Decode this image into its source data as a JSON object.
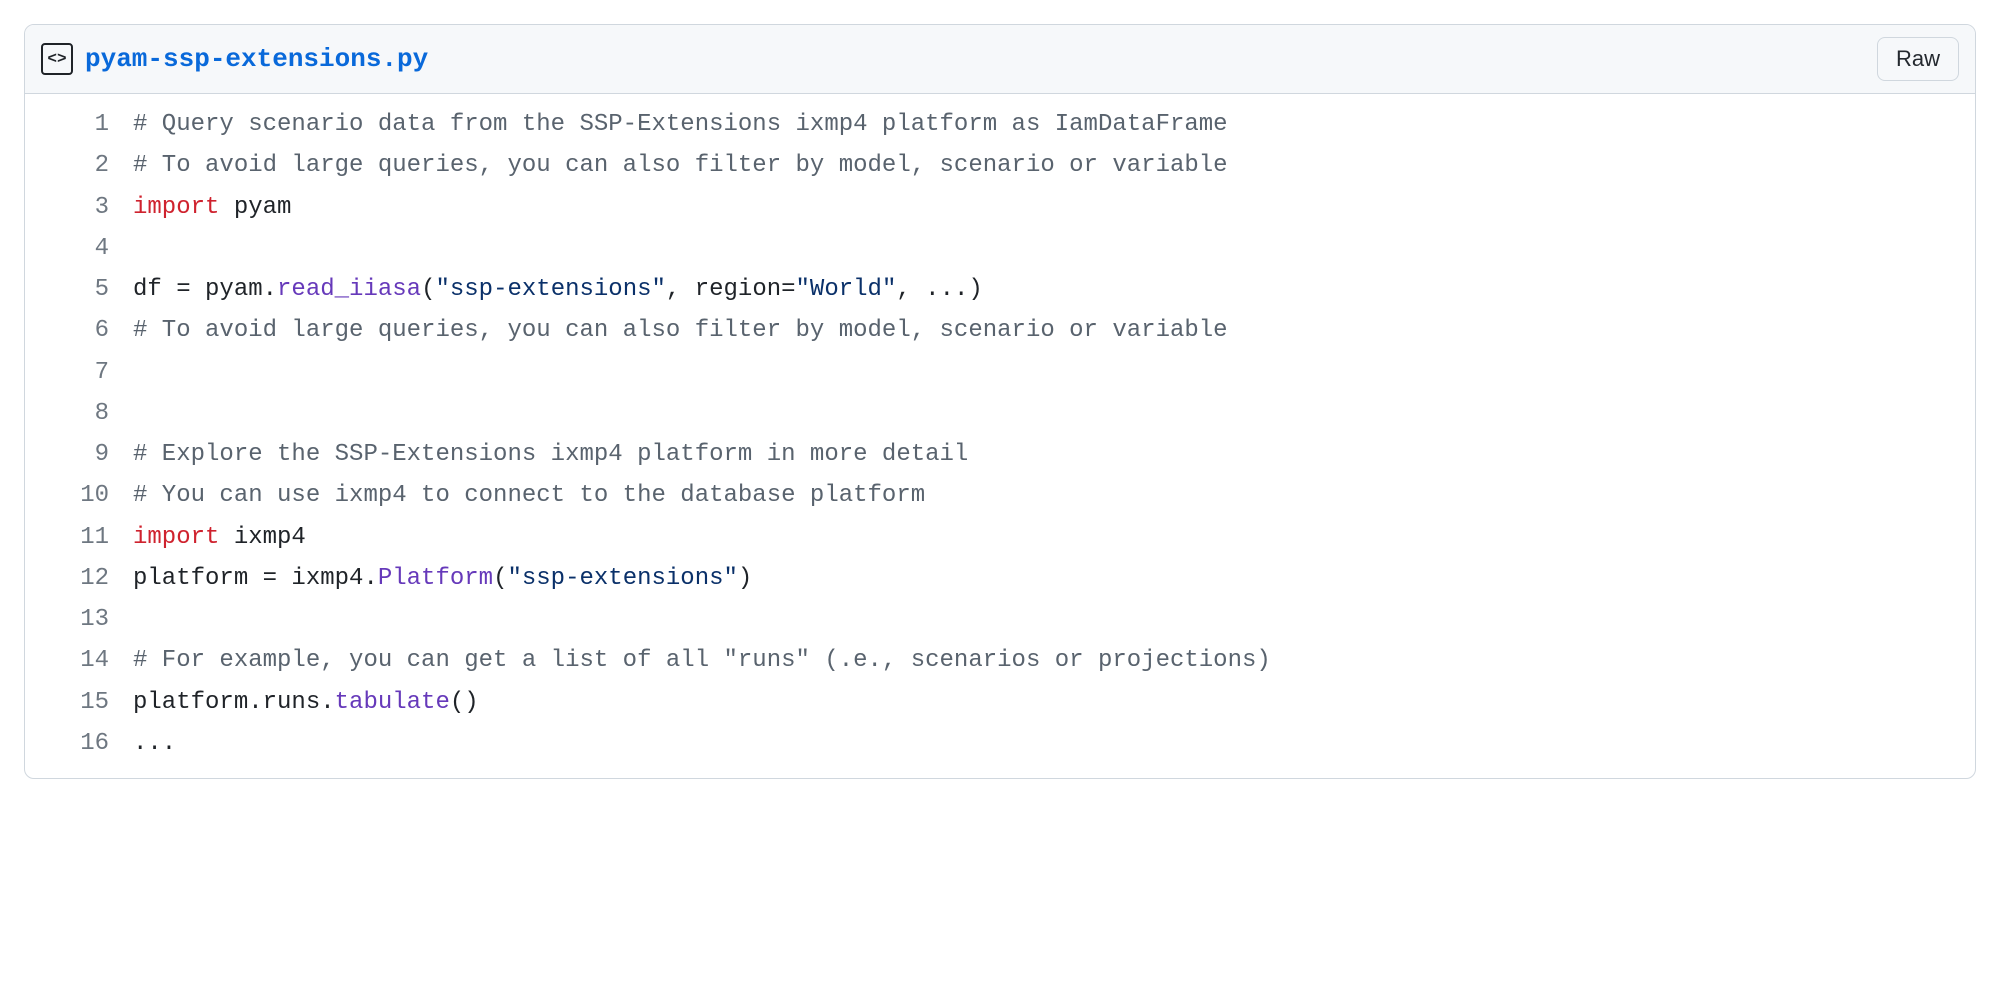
{
  "header": {
    "icon_glyph": "<>",
    "filename": "pyam-ssp-extensions.py",
    "raw_label": "Raw"
  },
  "code": {
    "lines": [
      {
        "n": "1",
        "tokens": [
          {
            "cls": "tok-comment",
            "t": "# Query scenario data from the SSP-Extensions ixmp4 platform as IamDataFrame"
          }
        ]
      },
      {
        "n": "2",
        "tokens": [
          {
            "cls": "tok-comment",
            "t": "# To avoid large queries, you can also filter by model, scenario or variable"
          }
        ]
      },
      {
        "n": "3",
        "tokens": [
          {
            "cls": "tok-keyword",
            "t": "import"
          },
          {
            "cls": "tok-default",
            "t": " pyam"
          }
        ]
      },
      {
        "n": "4",
        "tokens": [
          {
            "cls": "tok-default",
            "t": ""
          }
        ]
      },
      {
        "n": "5",
        "tokens": [
          {
            "cls": "tok-default",
            "t": "df = pyam."
          },
          {
            "cls": "tok-func",
            "t": "read_iiasa"
          },
          {
            "cls": "tok-default",
            "t": "("
          },
          {
            "cls": "tok-string",
            "t": "\"ssp-extensions\""
          },
          {
            "cls": "tok-default",
            "t": ", region="
          },
          {
            "cls": "tok-string",
            "t": "\"World\""
          },
          {
            "cls": "tok-default",
            "t": ", ...)"
          }
        ]
      },
      {
        "n": "6",
        "tokens": [
          {
            "cls": "tok-comment",
            "t": "# To avoid large queries, you can also filter by model, scenario or variable"
          }
        ]
      },
      {
        "n": "7",
        "tokens": [
          {
            "cls": "tok-default",
            "t": ""
          }
        ]
      },
      {
        "n": "8",
        "tokens": [
          {
            "cls": "tok-default",
            "t": ""
          }
        ]
      },
      {
        "n": "9",
        "tokens": [
          {
            "cls": "tok-comment",
            "t": "# Explore the SSP-Extensions ixmp4 platform in more detail"
          }
        ]
      },
      {
        "n": "10",
        "tokens": [
          {
            "cls": "tok-comment",
            "t": "# You can use ixmp4 to connect to the database platform"
          }
        ]
      },
      {
        "n": "11",
        "tokens": [
          {
            "cls": "tok-keyword",
            "t": "import"
          },
          {
            "cls": "tok-default",
            "t": " ixmp4"
          }
        ]
      },
      {
        "n": "12",
        "tokens": [
          {
            "cls": "tok-default",
            "t": "platform = ixmp4."
          },
          {
            "cls": "tok-func",
            "t": "Platform"
          },
          {
            "cls": "tok-default",
            "t": "("
          },
          {
            "cls": "tok-string",
            "t": "\"ssp-extensions\""
          },
          {
            "cls": "tok-default",
            "t": ")"
          }
        ]
      },
      {
        "n": "13",
        "tokens": [
          {
            "cls": "tok-default",
            "t": ""
          }
        ]
      },
      {
        "n": "14",
        "tokens": [
          {
            "cls": "tok-comment",
            "t": "# For example, you can get a list of all \"runs\" (.e., scenarios or projections)"
          }
        ]
      },
      {
        "n": "15",
        "tokens": [
          {
            "cls": "tok-default",
            "t": "platform.runs."
          },
          {
            "cls": "tok-func",
            "t": "tabulate"
          },
          {
            "cls": "tok-default",
            "t": "()"
          }
        ]
      },
      {
        "n": "16",
        "tokens": [
          {
            "cls": "tok-default",
            "t": "..."
          }
        ]
      }
    ]
  }
}
